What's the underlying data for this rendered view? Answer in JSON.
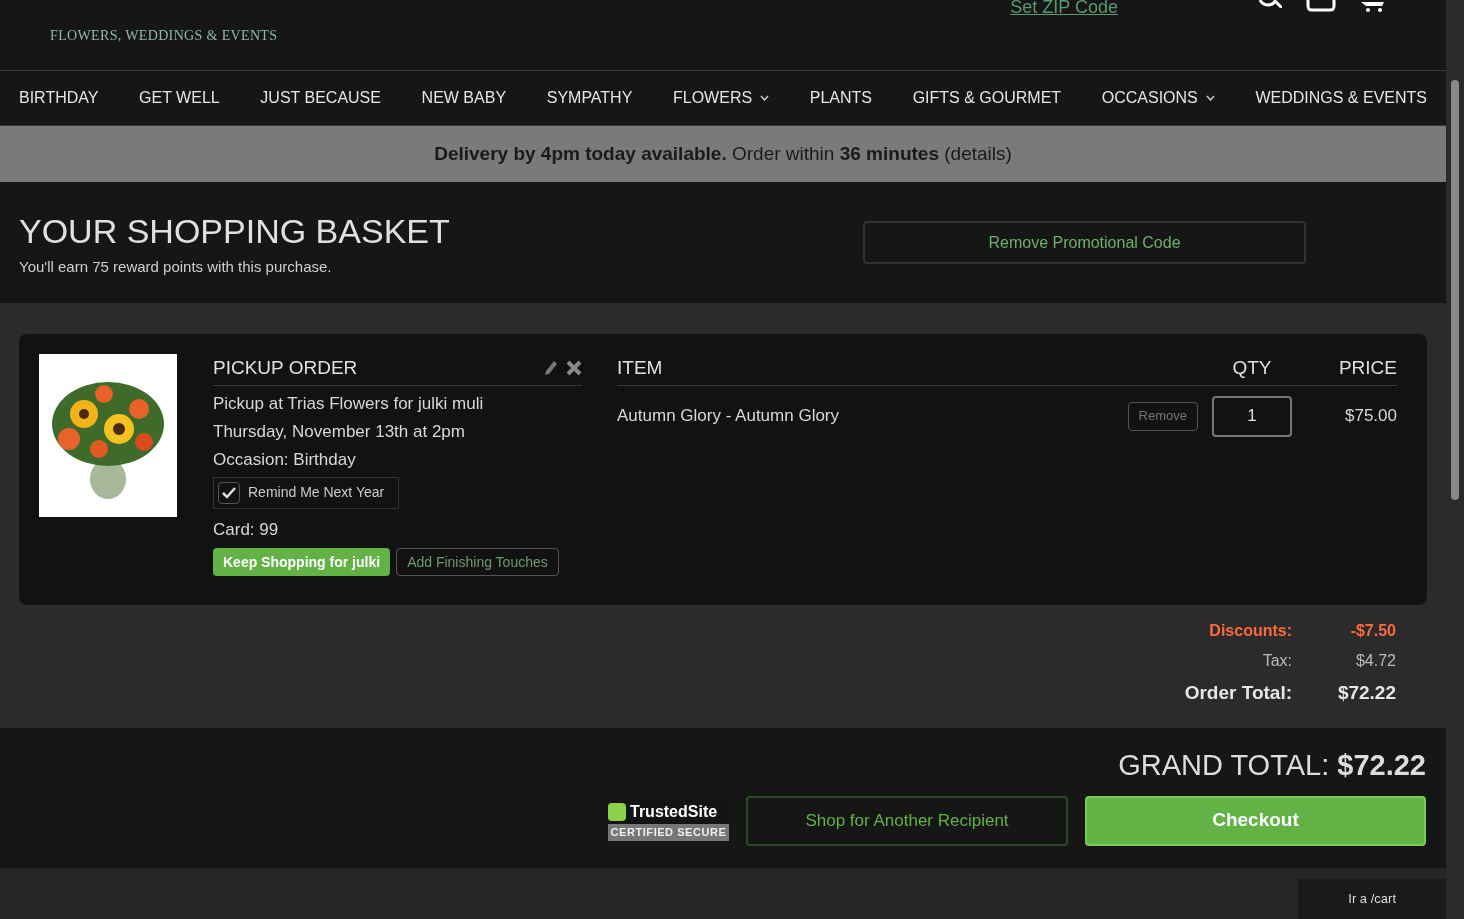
{
  "header": {
    "tagline": "FLOWERS, WEDDINGS & EVENTS",
    "zip_link": "Set ZIP Code"
  },
  "nav": [
    {
      "label": "BIRTHDAY",
      "dropdown": false
    },
    {
      "label": "GET WELL",
      "dropdown": false
    },
    {
      "label": "JUST BECAUSE",
      "dropdown": false
    },
    {
      "label": "NEW BABY",
      "dropdown": false
    },
    {
      "label": "SYMPATHY",
      "dropdown": false
    },
    {
      "label": "FLOWERS",
      "dropdown": true
    },
    {
      "label": "PLANTS",
      "dropdown": false
    },
    {
      "label": "GIFTS & GOURMET",
      "dropdown": false
    },
    {
      "label": "OCCASIONS",
      "dropdown": true
    },
    {
      "label": "WEDDINGS & EVENTS",
      "dropdown": false
    }
  ],
  "banner": {
    "text": "**Delivery by 4pm today available.** Order within **36 minutes** (",
    "link": "details",
    "end": ")"
  },
  "basket": {
    "title": "YOUR SHOPPING BASKET",
    "points": "You'll earn 75 reward points with this purchase.",
    "promo_button": "Remove Promotional Code"
  },
  "order": {
    "heading": "PICKUP ORDER",
    "lines": [
      "Pickup at Trias Flowers for julki muli",
      "Thursday, November 13th at 2pm",
      "Occasion: Birthday"
    ],
    "remind": {
      "label": "Remind Me Next Year",
      "checked": true
    },
    "card": "Card: 99",
    "keep_button": "Keep Shopping for julki",
    "touches_button": "Add Finishing Touches"
  },
  "items": {
    "columns": [
      "ITEM",
      "QTY",
      "PRICE"
    ],
    "rows": [
      {
        "name": "Autumn Glory - Autumn Glory",
        "remove": "Remove",
        "qty": "1",
        "price": "$75.00"
      }
    ]
  },
  "totals": [
    {
      "label": "Discounts:",
      "value": "-$7.50",
      "kind": "discount"
    },
    {
      "label": "Tax:",
      "value": "$4.72",
      "kind": "normal"
    },
    {
      "label": "Order Total:",
      "value": "$72.22",
      "kind": "total"
    }
  ],
  "footer": {
    "grand_label": "GRAND TOTAL:",
    "grand_value": "$72.22",
    "badge_top": "TrustedSite",
    "badge_bottom": "CERTIFIED SECURE",
    "another_button": "Shop for Another Recipient",
    "checkout_button": "Checkout"
  },
  "status_url": "Ir a /cart"
}
